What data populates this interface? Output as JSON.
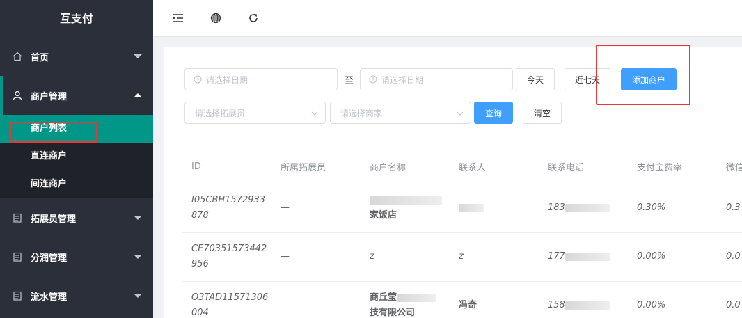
{
  "app": {
    "title": "互支付"
  },
  "sidebar": {
    "items": [
      {
        "label": "首页",
        "icon": "home-icon"
      },
      {
        "label": "商户管理",
        "icon": "user-icon",
        "open": true,
        "children": [
          {
            "label": "商户列表",
            "active": true
          },
          {
            "label": "直连商户"
          },
          {
            "label": "间连商户"
          }
        ]
      },
      {
        "label": "拓展员管理",
        "icon": "clipboard-icon"
      },
      {
        "label": "分润管理",
        "icon": "clipboard-icon"
      },
      {
        "label": "流水管理",
        "icon": "clipboard-icon"
      }
    ]
  },
  "filters": {
    "start_date_placeholder": "请选择日期",
    "to_label": "至",
    "end_date_placeholder": "请选择日期",
    "today_label": "今天",
    "last7_label": "近七天",
    "add_merchant_label": "添加商户",
    "promoter_placeholder": "请选择拓展员",
    "merchant_placeholder": "请选择商家",
    "query_label": "查询",
    "clear_label": "清空"
  },
  "table": {
    "headers": [
      "ID",
      "所属拓展员",
      "商户名称",
      "联系人",
      "联系电话",
      "支付宝费率",
      "微信"
    ],
    "rows": [
      {
        "id_line1": "I05CBH1572933",
        "id_line2": "878",
        "promoter": "—",
        "name_line1": "",
        "name_line2": "家饭店",
        "contact": "",
        "phone": "183",
        "alipay_rate": "0.30%",
        "wechat_rate": "0.3"
      },
      {
        "id_line1": "CE70351573442",
        "id_line2": "956",
        "promoter": "—",
        "name_line1": "z",
        "name_line2": "",
        "contact": "z",
        "phone": "177",
        "alipay_rate": "0.00%",
        "wechat_rate": "0.0"
      },
      {
        "id_line1": "O3TAD11571306",
        "id_line2": "004",
        "promoter": "—",
        "name_line1": "商丘莹",
        "name_line2": "技有限公司",
        "contact": "冯奇",
        "phone": "158",
        "alipay_rate": "0.00%",
        "wechat_rate": "0.0"
      }
    ]
  },
  "colors": {
    "sidebar_bg": "#2b2f3a",
    "active_teal": "#009688",
    "primary_blue": "#409eff",
    "highlight_red": "#e53935"
  }
}
